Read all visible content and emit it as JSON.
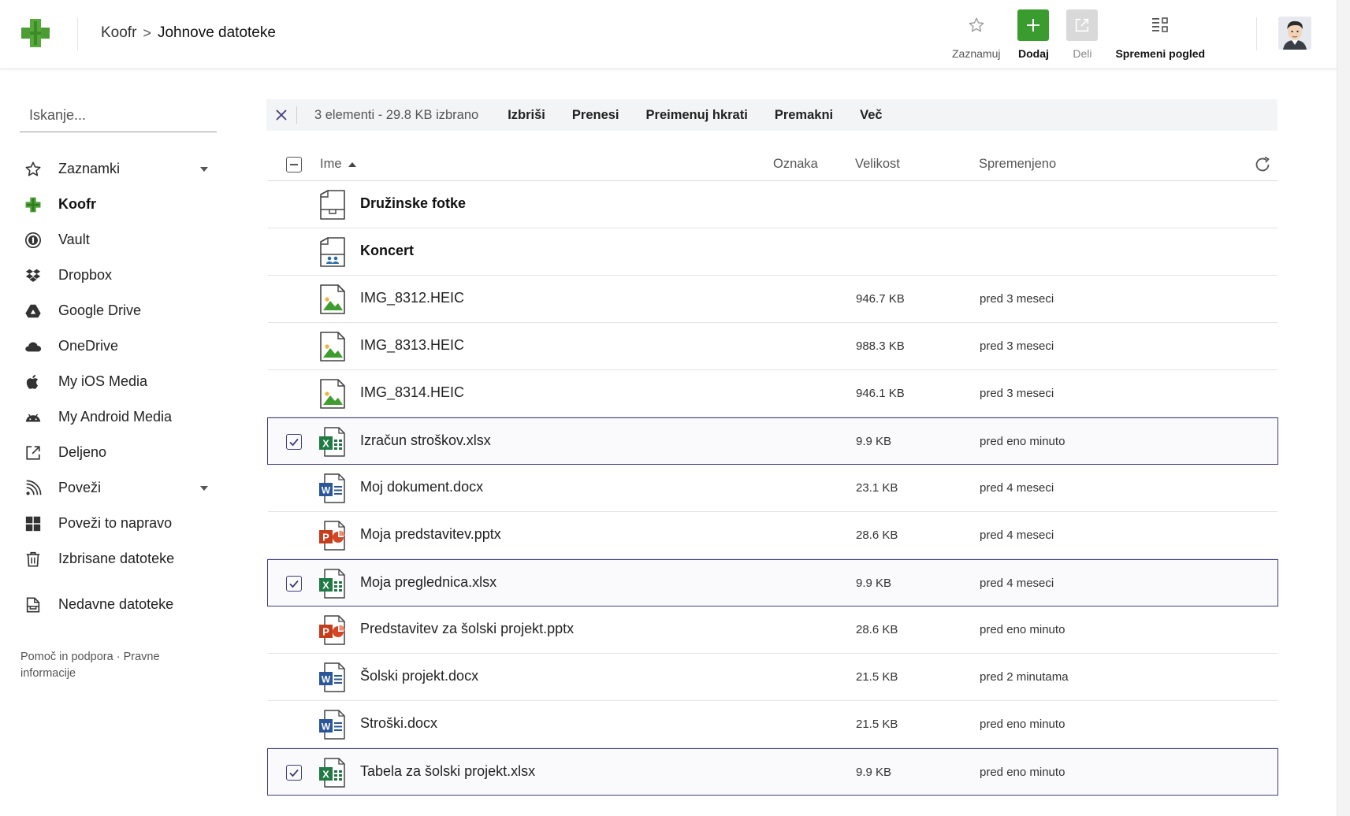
{
  "header": {
    "breadcrumb_root": "Koofr",
    "breadcrumb_sep": ">",
    "breadcrumb_current": "Johnove datoteke",
    "actions": {
      "bookmark": "Zaznamuj",
      "add": "Dodaj",
      "share": "Deli",
      "change_view": "Spremeni pogled"
    },
    "accent_color": "#3a9b2e"
  },
  "sidebar": {
    "search_placeholder": "Iskanje...",
    "items": [
      {
        "label": "Zaznamki",
        "icon": "star-icon"
      },
      {
        "label": "Koofr",
        "icon": "koofr-logo-icon",
        "active": true
      },
      {
        "label": "Vault",
        "icon": "vault-icon"
      },
      {
        "label": "Dropbox",
        "icon": "dropbox-icon"
      },
      {
        "label": "Google Drive",
        "icon": "google-drive-icon"
      },
      {
        "label": "OneDrive",
        "icon": "onedrive-icon"
      },
      {
        "label": "My iOS Media",
        "icon": "apple-icon"
      },
      {
        "label": "My Android Media",
        "icon": "android-icon"
      },
      {
        "label": "Deljeno",
        "icon": "share-icon"
      },
      {
        "label": "Poveži",
        "icon": "rss-icon"
      },
      {
        "label": "Poveži to napravo",
        "icon": "windows-icon"
      },
      {
        "label": "Izbrisane datoteke",
        "icon": "trash-icon"
      },
      {
        "label": "Nedavne datoteke",
        "icon": "recent-files-icon"
      }
    ],
    "footer": "Pomoč in podpora · Pravne informacije"
  },
  "selection_bar": {
    "count_text": "3 elementi - 29.8 KB izbrano",
    "actions": [
      "Izbriši",
      "Prenesi",
      "Preimenuj hkrati",
      "Premakni",
      "Več"
    ]
  },
  "table": {
    "columns": {
      "name": "Ime",
      "tag": "Oznaka",
      "size": "Velikost",
      "modified": "Spremenjeno"
    },
    "rows": [
      {
        "name": "Družinske fotke",
        "size": "",
        "modified": "",
        "type": "folder",
        "selected": false
      },
      {
        "name": "Koncert",
        "size": "",
        "modified": "",
        "type": "shared-folder",
        "selected": false
      },
      {
        "name": "IMG_8312.HEIC",
        "size": "946.7 KB",
        "modified": "pred 3 meseci",
        "type": "image",
        "selected": false
      },
      {
        "name": "IMG_8313.HEIC",
        "size": "988.3 KB",
        "modified": "pred 3 meseci",
        "type": "image",
        "selected": false
      },
      {
        "name": "IMG_8314.HEIC",
        "size": "946.1 KB",
        "modified": "pred 3 meseci",
        "type": "image",
        "selected": false
      },
      {
        "name": "Izračun stroškov.xlsx",
        "size": "9.9 KB",
        "modified": "pred eno minuto",
        "type": "excel",
        "selected": true
      },
      {
        "name": "Moj dokument.docx",
        "size": "23.1 KB",
        "modified": "pred 4 meseci",
        "type": "word",
        "selected": false
      },
      {
        "name": "Moja predstavitev.pptx",
        "size": "28.6 KB",
        "modified": "pred 4 meseci",
        "type": "powerpoint",
        "selected": false
      },
      {
        "name": "Moja preglednica.xlsx",
        "size": "9.9 KB",
        "modified": "pred 4 meseci",
        "type": "excel",
        "selected": true
      },
      {
        "name": "Predstavitev za šolski projekt.pptx",
        "size": "28.6 KB",
        "modified": "pred eno minuto",
        "type": "powerpoint",
        "selected": false
      },
      {
        "name": "Šolski projekt.docx",
        "size": "21.5 KB",
        "modified": "pred 2 minutama",
        "type": "word",
        "selected": false
      },
      {
        "name": "Stroški.docx",
        "size": "21.5 KB",
        "modified": "pred eno minuto",
        "type": "word",
        "selected": false
      },
      {
        "name": "Tabela za šolski projekt.xlsx",
        "size": "9.9 KB",
        "modified": "pred eno minuto",
        "type": "excel",
        "selected": true
      }
    ]
  }
}
